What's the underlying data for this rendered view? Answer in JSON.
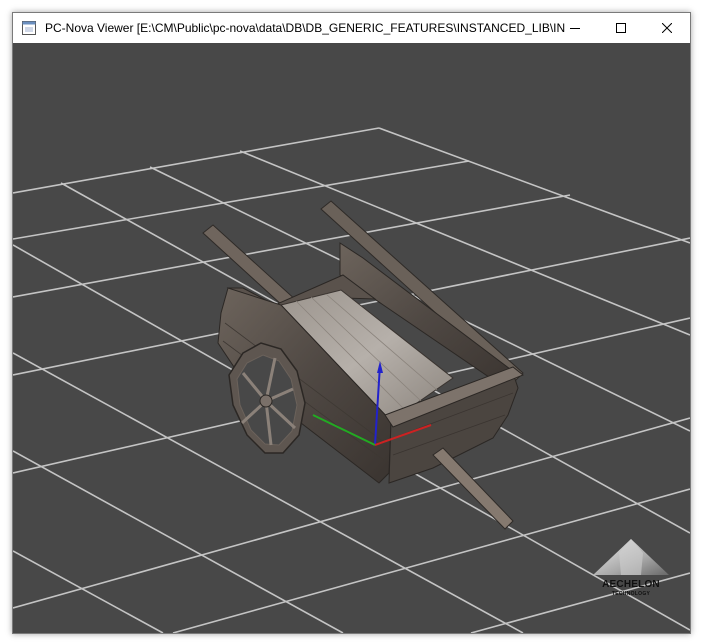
{
  "window": {
    "title": "PC-Nova Viewer [E:\\CM\\Public\\pc-nova\\data\\DB\\DB_GENERIC_FEATURES\\INSTANCED_LIB\\IN...",
    "icon": "app-window-icon",
    "controls": {
      "minimize_icon": "minimize-icon",
      "maximize_icon": "maximize-icon",
      "close_icon": "close-icon"
    }
  },
  "viewport": {
    "background_color": "#484848",
    "grid_color": "#c8c8c8",
    "model": "wooden-cart",
    "axes": {
      "x_color": "#cc2222",
      "y_color": "#22aa22",
      "z_color": "#2222cc"
    }
  },
  "logo": {
    "name": "AECHELON",
    "tagline": "TECHNOLOGY"
  }
}
